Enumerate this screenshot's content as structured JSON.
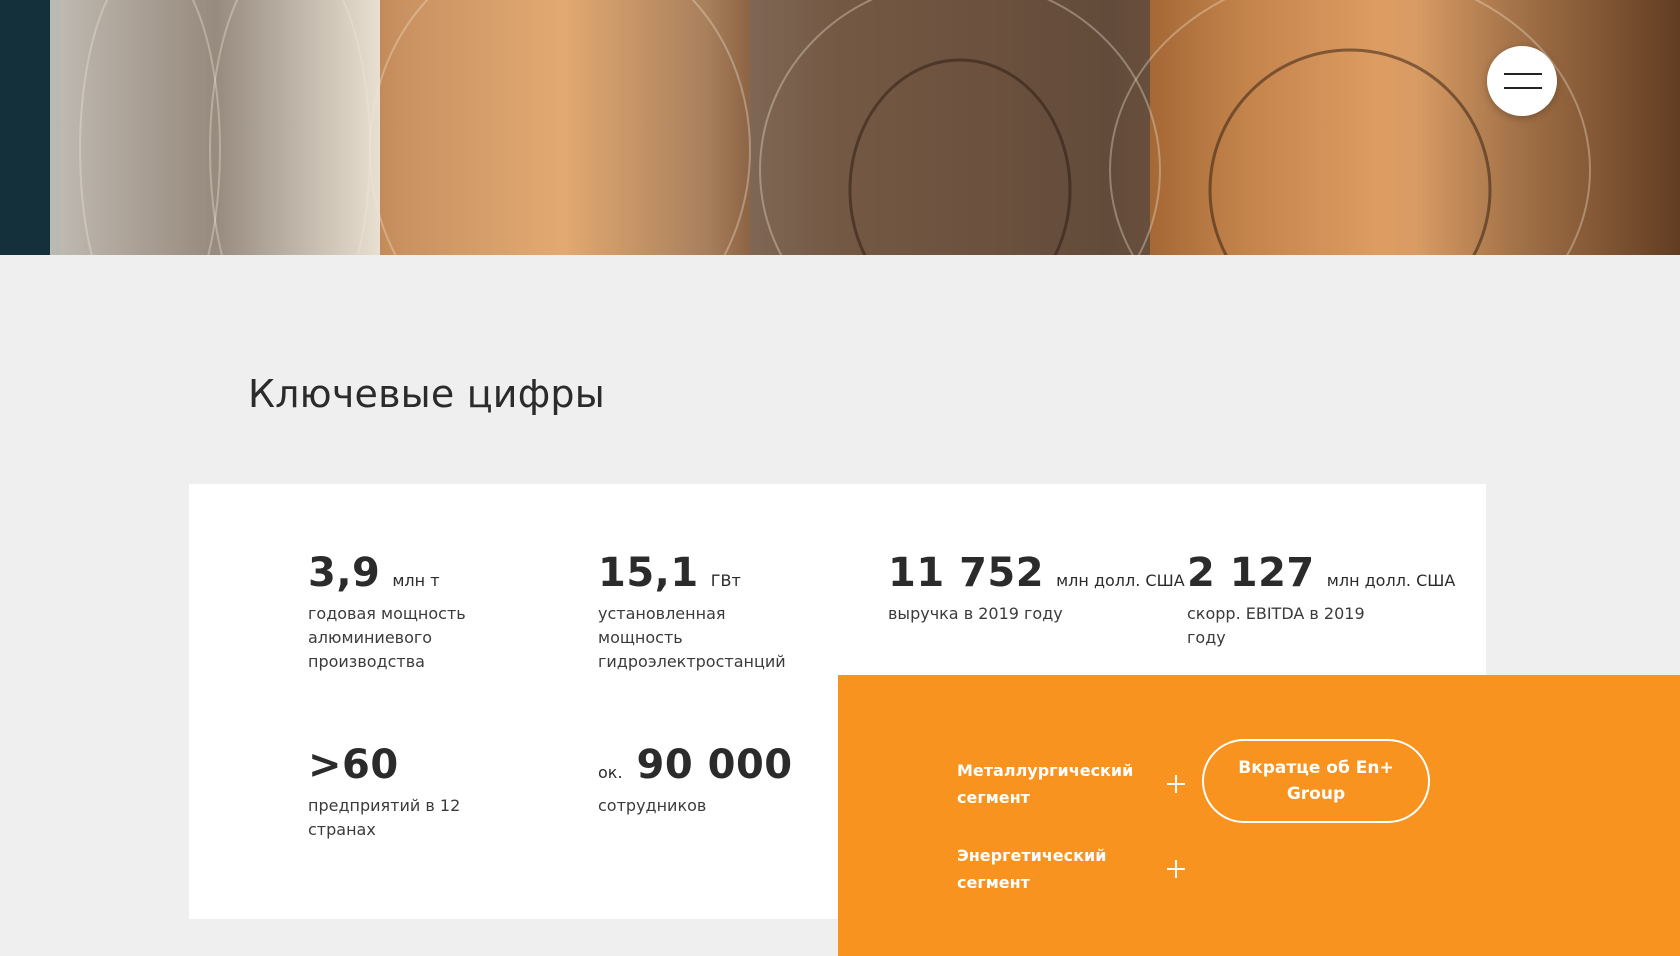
{
  "header": {
    "menu_icon": "hamburger-menu-icon"
  },
  "key_figures": {
    "title": "Ключевые цифры",
    "stats": [
      {
        "value": "3,9",
        "unit": "млн т",
        "description": "годовая мощность алюминиевого производства"
      },
      {
        "value": "15,1",
        "unit": "ГВт",
        "description": "установленная мощность гидроэлектростанций"
      },
      {
        "value": "11 752",
        "unit": "млн долл. США",
        "description": "выручка в 2019 году"
      },
      {
        "value": "2 127",
        "unit": "млн долл. США",
        "description": "скорр. EBITDA в 2019 году"
      },
      {
        "value": ">60",
        "unit": "",
        "description": "предприятий в 12 странах"
      },
      {
        "prefix": "ок.",
        "value": "90 000",
        "unit": "",
        "description": "сотрудников"
      }
    ]
  },
  "segments": {
    "items": [
      {
        "label": "Металлургический сегмент",
        "icon": "plus-icon"
      },
      {
        "label": "Энергетический сегмент",
        "icon": "plus-icon"
      }
    ],
    "about_button": "Вкратце об En+ Group"
  },
  "colors": {
    "accent": "#f7931e",
    "background": "#efefef",
    "card": "#ffffff",
    "text": "#2b2b2b"
  }
}
